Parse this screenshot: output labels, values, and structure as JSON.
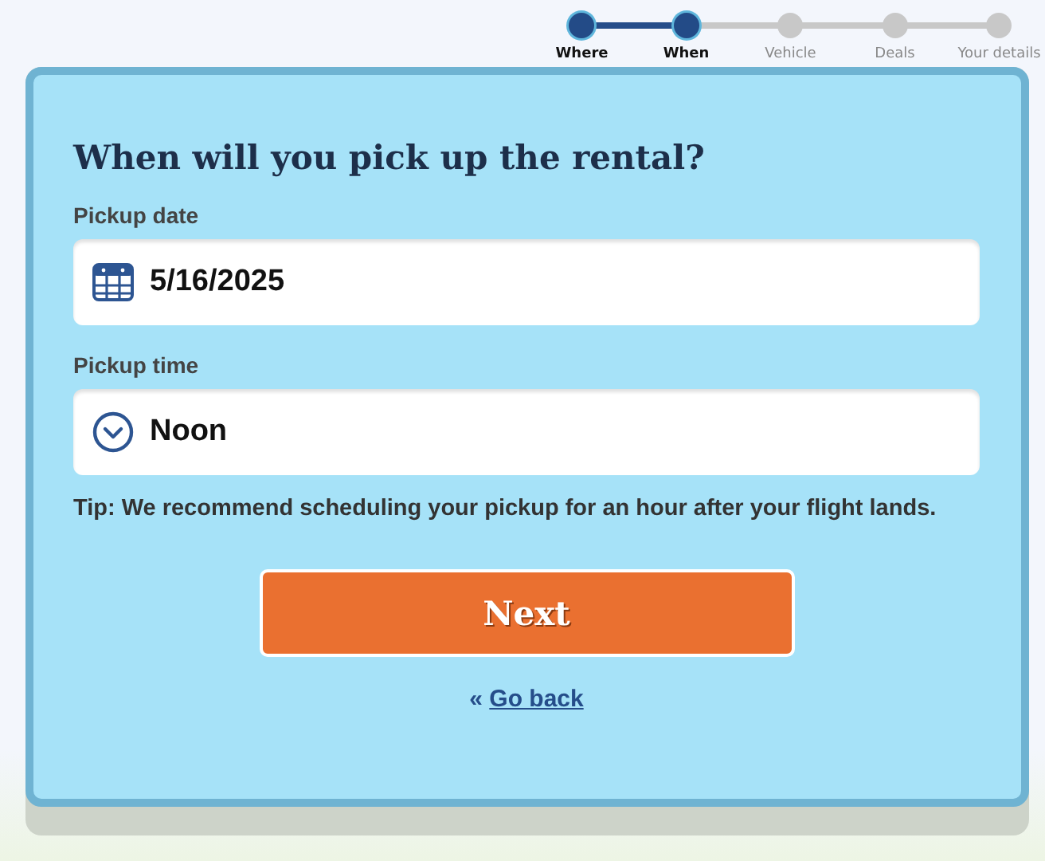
{
  "steps": [
    {
      "label": "Where",
      "completed": true
    },
    {
      "label": "When",
      "completed": true
    },
    {
      "label": "Vehicle",
      "completed": false
    },
    {
      "label": "Deals",
      "completed": false
    },
    {
      "label": "Your details",
      "completed": false
    }
  ],
  "form": {
    "title": "When will you pick up the rental?",
    "fields": [
      {
        "kind": "date",
        "label": "Pickup date",
        "value": "5/16/2025"
      },
      {
        "kind": "time",
        "label": "Pickup time",
        "value": "Noon"
      }
    ],
    "tip": "Tip: We recommend scheduling your pickup for an hour after your flight lands.",
    "button": "Next",
    "back_mark": "«",
    "back_link": "Go back"
  }
}
